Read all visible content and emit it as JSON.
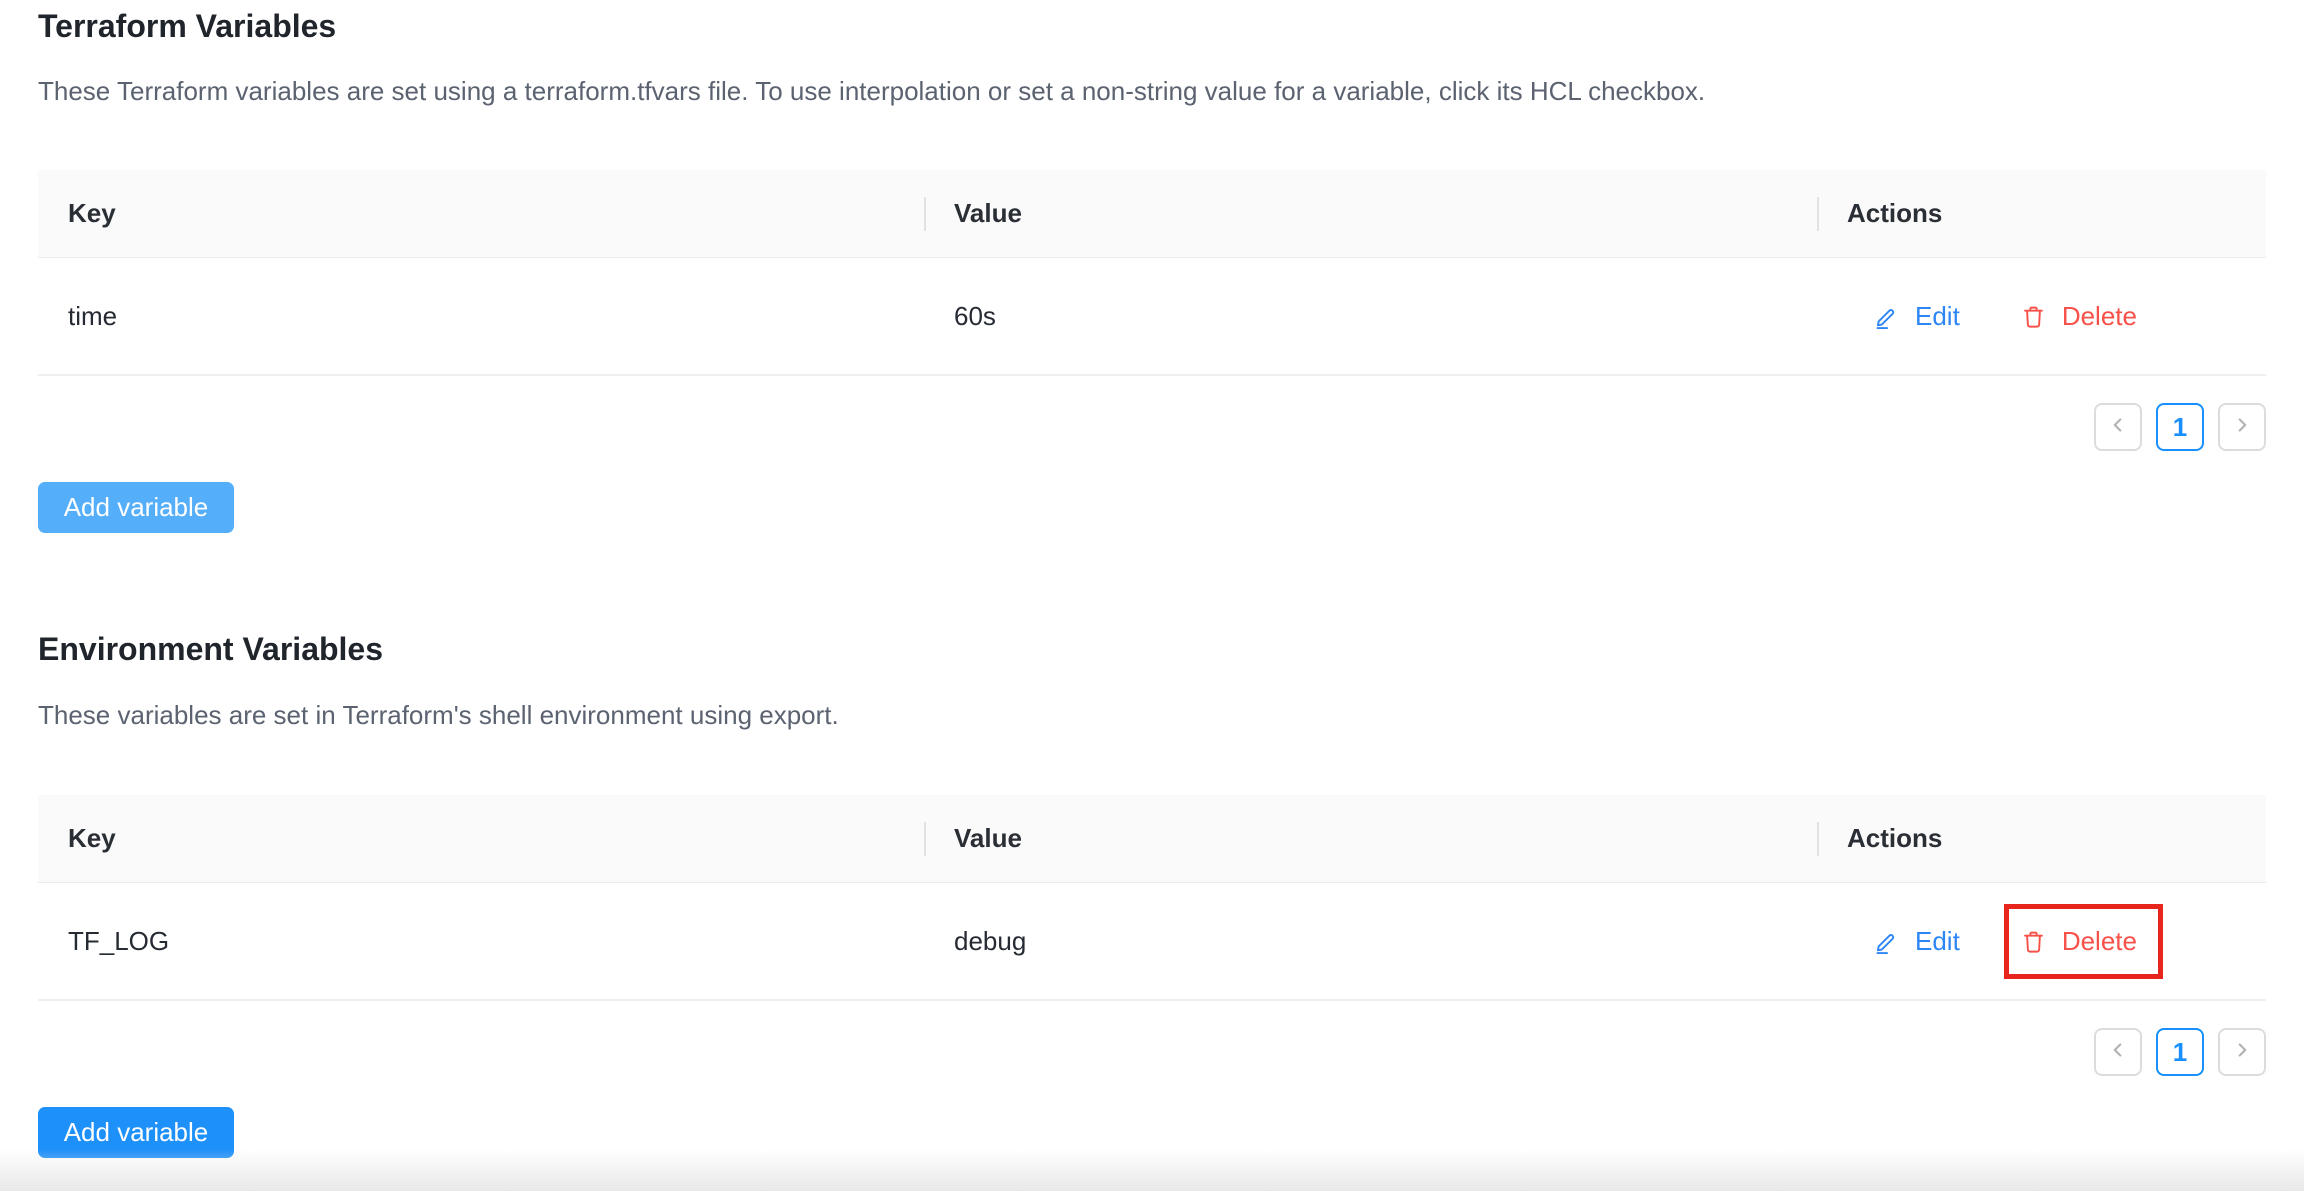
{
  "sections": [
    {
      "title": "Terraform Variables",
      "description": "These Terraform variables are set using a terraform.tfvars file. To use interpolation or set a non-string value for a variable, click its HCL checkbox.",
      "table": {
        "columns": [
          "Key",
          "Value",
          "Actions"
        ],
        "rows": [
          {
            "key": "time",
            "value": "60s"
          }
        ]
      },
      "pagination": {
        "current_page": "1"
      },
      "add_button_label": "Add variable"
    },
    {
      "title": "Environment Variables",
      "description": "These variables are set in Terraform's shell environment using export.",
      "table": {
        "columns": [
          "Key",
          "Value",
          "Actions"
        ],
        "rows": [
          {
            "key": "TF_LOG",
            "value": "debug"
          }
        ]
      },
      "pagination": {
        "current_page": "1"
      },
      "add_button_label": "Add variable",
      "delete_highlighted": true
    }
  ],
  "row_actions": {
    "edit_label": "Edit",
    "delete_label": "Delete"
  },
  "colors": {
    "edit_link_blue": "#2e86f6",
    "delete_red": "#f8514a",
    "highlight_box_red": "#e8251c",
    "pagination_active_blue": "#1890ff",
    "add_button_light_blue": "#55aef9",
    "add_button_primary_blue": "#1e90fa",
    "table_header_bg": "#fafafa"
  }
}
